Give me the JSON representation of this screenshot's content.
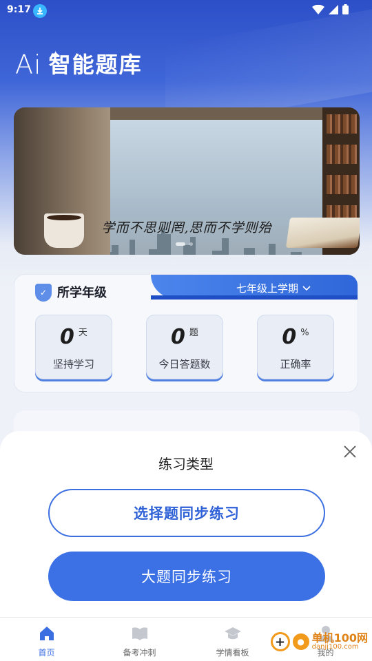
{
  "status_bar": {
    "time": "9:17"
  },
  "app": {
    "logo_ai": "Ai",
    "title": "智能题库"
  },
  "banner": {
    "quote": "学而不思则罔,思而不学则殆",
    "slide_count": 2,
    "active_slide": 1
  },
  "grade": {
    "title": "所学年级",
    "selected": "七年级上学期"
  },
  "stats": [
    {
      "value": "0",
      "unit": "天",
      "label": "坚持学习"
    },
    {
      "value": "0",
      "unit": "题",
      "label": "今日答题数"
    },
    {
      "value": "0",
      "unit": "%",
      "label": "正确率"
    }
  ],
  "sheet": {
    "title": "练习类型",
    "option_choice": "选择题同步练习",
    "option_big": "大题同步练习"
  },
  "nav": {
    "items": [
      {
        "label": "首页",
        "icon": "home-icon",
        "active": true
      },
      {
        "label": "备考冲刺",
        "icon": "book-icon",
        "active": false
      },
      {
        "label": "学情看板",
        "icon": "graduation-cap-icon",
        "active": false
      },
      {
        "label": "我的",
        "icon": "profile-icon",
        "active": false
      }
    ]
  },
  "watermark": {
    "name": "单机100网",
    "url": "danji100.com"
  },
  "colors": {
    "primary": "#3c71e6",
    "header": "#2c4fc7"
  }
}
